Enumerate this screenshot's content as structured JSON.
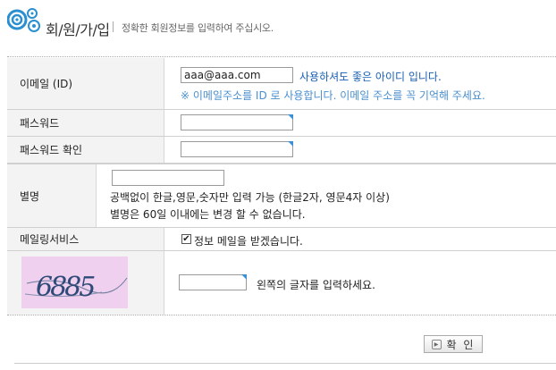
{
  "header": {
    "title": "회/원/가/입",
    "subtitle": "정확한 회원정보를 입력하여 주십시오."
  },
  "form": {
    "email": {
      "label": "이메일 (ID)",
      "value": "aaa@aaa.com",
      "status": "사용하셔도 좋은 아이디 입니다.",
      "hint": "※ 이메일주소를 ID 로 사용합니다. 이메일 주소를 꼭 기억해 주세요."
    },
    "password": {
      "label": "패스워드",
      "value": ""
    },
    "password_confirm": {
      "label": "패스워드 확인",
      "value": ""
    },
    "nickname": {
      "label": "별명",
      "value": "",
      "help_1": "공백없이 한글,영문,숫자만 입력 가능 (한글2자, 영문4자 이상)",
      "help_2": "별명은 60일 이내에는 변경 할 수 없습니다."
    },
    "mailing": {
      "label": "메일링서비스",
      "checkbox_label": "정보 메일을 받겠습니다.",
      "checked": true
    },
    "captcha": {
      "image_text": "6885",
      "value": "",
      "instruction": "왼쪽의 글자를 입력하세요."
    }
  },
  "actions": {
    "confirm_label": "확 인"
  }
}
